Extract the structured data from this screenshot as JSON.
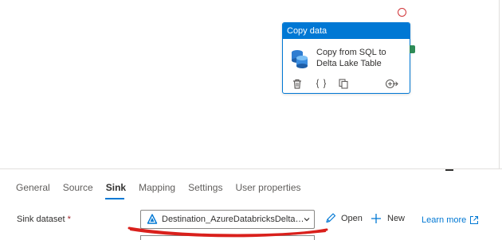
{
  "activity": {
    "type_label": "Copy data",
    "name": "Copy from SQL to Delta Lake Table"
  },
  "tabs": [
    {
      "label": "General"
    },
    {
      "label": "Source"
    },
    {
      "label": "Sink",
      "active": true
    },
    {
      "label": "Mapping"
    },
    {
      "label": "Settings"
    },
    {
      "label": "User properties"
    }
  ],
  "sink": {
    "label": "Sink dataset",
    "required_mark": "*",
    "dataset_value": "Destination_AzureDatabricksDeltaLakeDataset",
    "open_label": "Open",
    "new_label": "New",
    "learn_more_label": "Learn more"
  },
  "icons": {
    "activity": "database-copy-icon",
    "delete": "trash-icon",
    "code": "code-braces-icon",
    "clone": "copy-icon",
    "add_output": "arrow-circle-icon",
    "dataset": "azure-databricks-icon",
    "open": "pencil-icon",
    "new": "plus-icon",
    "external": "external-link-icon"
  },
  "colors": {
    "accent": "#0078d4",
    "annotation_red": "#d9201c",
    "success": "#2e8b57"
  }
}
